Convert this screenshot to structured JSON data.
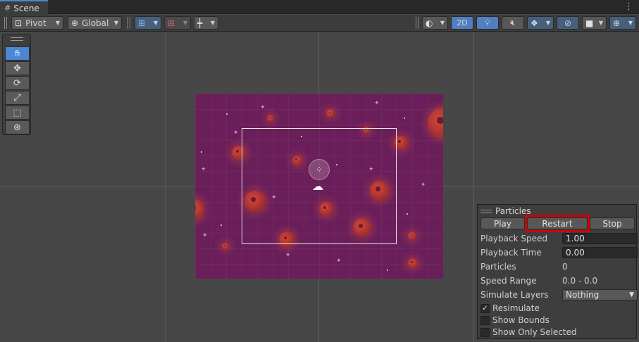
{
  "tab": {
    "title": "Scene",
    "icon": "hash-icon"
  },
  "toolbar": {
    "pivot_label": "Pivot",
    "global_label": "Global",
    "mode_2d_label": "2D"
  },
  "tools": [
    "hand-tool",
    "move-tool",
    "rotate-tool",
    "scale-tool",
    "rect-tool",
    "transform-tool"
  ],
  "particles": {
    "title": "Particles",
    "play_label": "Play",
    "restart_label": "Restart",
    "stop_label": "Stop",
    "fields": {
      "playback_speed_label": "Playback Speed",
      "playback_speed_value": "1.00",
      "playback_time_label": "Playback Time",
      "playback_time_value": "0.00",
      "particles_label": "Particles",
      "particles_value": "0",
      "speed_range_label": "Speed Range",
      "speed_range_value": "0.0 - 0.0",
      "simulate_layers_label": "Simulate Layers",
      "simulate_layers_value": "Nothing"
    },
    "checkboxes": {
      "resimulate_label": "Resimulate",
      "resimulate_checked": true,
      "show_bounds_label": "Show Bounds",
      "show_bounds_checked": false,
      "show_only_selected_label": "Show Only Selected",
      "show_only_selected_checked": false
    }
  },
  "colors": {
    "accent": "#4a88d6",
    "highlight": "#d40000",
    "game_background": "#6a1f5a"
  }
}
